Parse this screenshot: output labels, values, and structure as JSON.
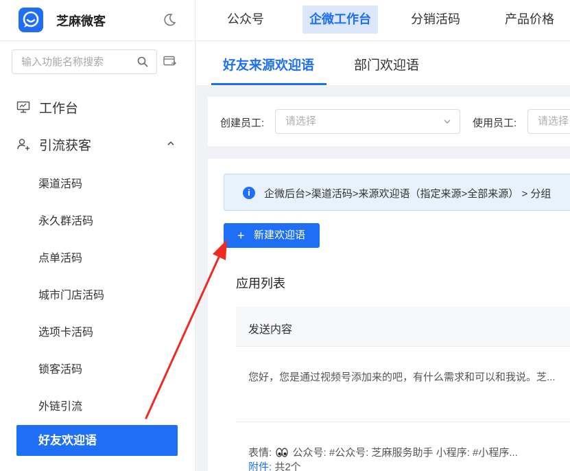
{
  "brand": {
    "name": "芝麻微客"
  },
  "topnav": [
    {
      "label": "公众号"
    },
    {
      "label": "企微工作台"
    },
    {
      "label": "分销活码"
    },
    {
      "label": "产品价格"
    }
  ],
  "sidebar": {
    "search_placeholder": "输入功能名称搜索",
    "workbench": "工作台",
    "group_label": "引流获客",
    "items": [
      {
        "label": "渠道活码"
      },
      {
        "label": "永久群活码"
      },
      {
        "label": "点单活码"
      },
      {
        "label": "城市门店活码"
      },
      {
        "label": "选项卡活码"
      },
      {
        "label": "锁客活码"
      },
      {
        "label": "外链引流"
      },
      {
        "label": "好友欢迎语"
      }
    ]
  },
  "tabs": [
    {
      "label": "好友来源欢迎语"
    },
    {
      "label": "部门欢迎语"
    }
  ],
  "filters": {
    "creator_label": "创建员工:",
    "creator_placeholder": "请选择",
    "user_label": "使用员工:",
    "user_placeholder": "请选择"
  },
  "info_bar": {
    "text": "企微后台>渠道活码>来源欢迎语（指定来源>全部来源） > 分组"
  },
  "new_button": {
    "label": "新建欢迎语"
  },
  "list": {
    "title": "应用列表",
    "column": "发送内容",
    "row1_text": "您好，您是通过视频号添加来的吧，有什么需求和可以和我说。芝...",
    "row2_line1_prefix": "表情:",
    "row2_line1_rest": "公众号: #公众号: 芝麻服务助手 小程序: #小程序...",
    "row2_attach_label": "附件:",
    "row2_attach_value": "共2个"
  },
  "colors": {
    "accent": "#1e6ff5",
    "annotation": "#ee2a23"
  }
}
